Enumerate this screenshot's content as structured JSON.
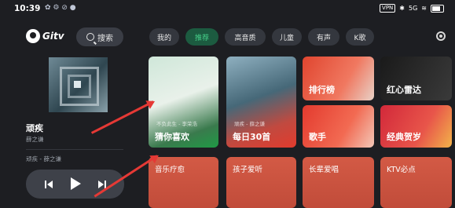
{
  "status": {
    "time": "10:39",
    "icons_left": "✿ ⚙ ⊘ ●",
    "vpn": "VPN",
    "bt": "✱",
    "net": "5G",
    "wifi": "≋"
  },
  "brand": {
    "logo_text": "Gitv"
  },
  "search": {
    "label": "搜索"
  },
  "tabs": [
    {
      "label": "我的",
      "active": false
    },
    {
      "label": "推荐",
      "active": true
    },
    {
      "label": "高音质",
      "active": false
    },
    {
      "label": "儿童",
      "active": false
    },
    {
      "label": "有声",
      "active": false
    },
    {
      "label": "K歌",
      "active": false
    }
  ],
  "now_playing": {
    "title": "顽疾",
    "artist": "薛之谦",
    "lyric": "顽疾 - 薛之谦"
  },
  "cards": {
    "guess": {
      "label": "猜你喜欢",
      "sub": "不负此生 - 李荣浩"
    },
    "daily": {
      "label": "每日30首",
      "sub": "顽疾 - 薛之谦"
    },
    "chart": {
      "label": "排行榜"
    },
    "radar": {
      "label": "红心雷达"
    },
    "singer": {
      "label": "歌手"
    },
    "newyear": {
      "label": "经典贺岁"
    },
    "healing": {
      "label": "音乐疗愈"
    },
    "kids": {
      "label": "孩子爱听"
    },
    "elder": {
      "label": "长辈爱唱"
    },
    "ktv": {
      "label": "KTV必点"
    }
  },
  "colors": {
    "accent": "#46d18a",
    "annotation": "#e53935"
  }
}
